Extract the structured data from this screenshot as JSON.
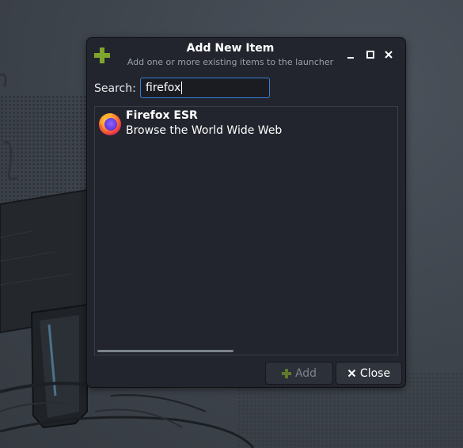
{
  "dialog": {
    "title": "Add New Item",
    "subtitle": "Add one or more existing items to the launcher",
    "icon": "plus-icon",
    "window_controls": [
      "minimize-icon",
      "maximize-icon",
      "close-icon"
    ]
  },
  "search": {
    "label": "Search:",
    "value": "firefox"
  },
  "results": [
    {
      "name": "Firefox ESR",
      "description": "Browse the World Wide Web",
      "icon": "firefox-icon"
    }
  ],
  "buttons": {
    "add_label": "Add",
    "add_enabled": false,
    "close_label": "Close"
  },
  "colors": {
    "accent_green": "#7fa52e",
    "focus_blue": "#3a7ed8",
    "dialog_bg": "#22252d"
  }
}
